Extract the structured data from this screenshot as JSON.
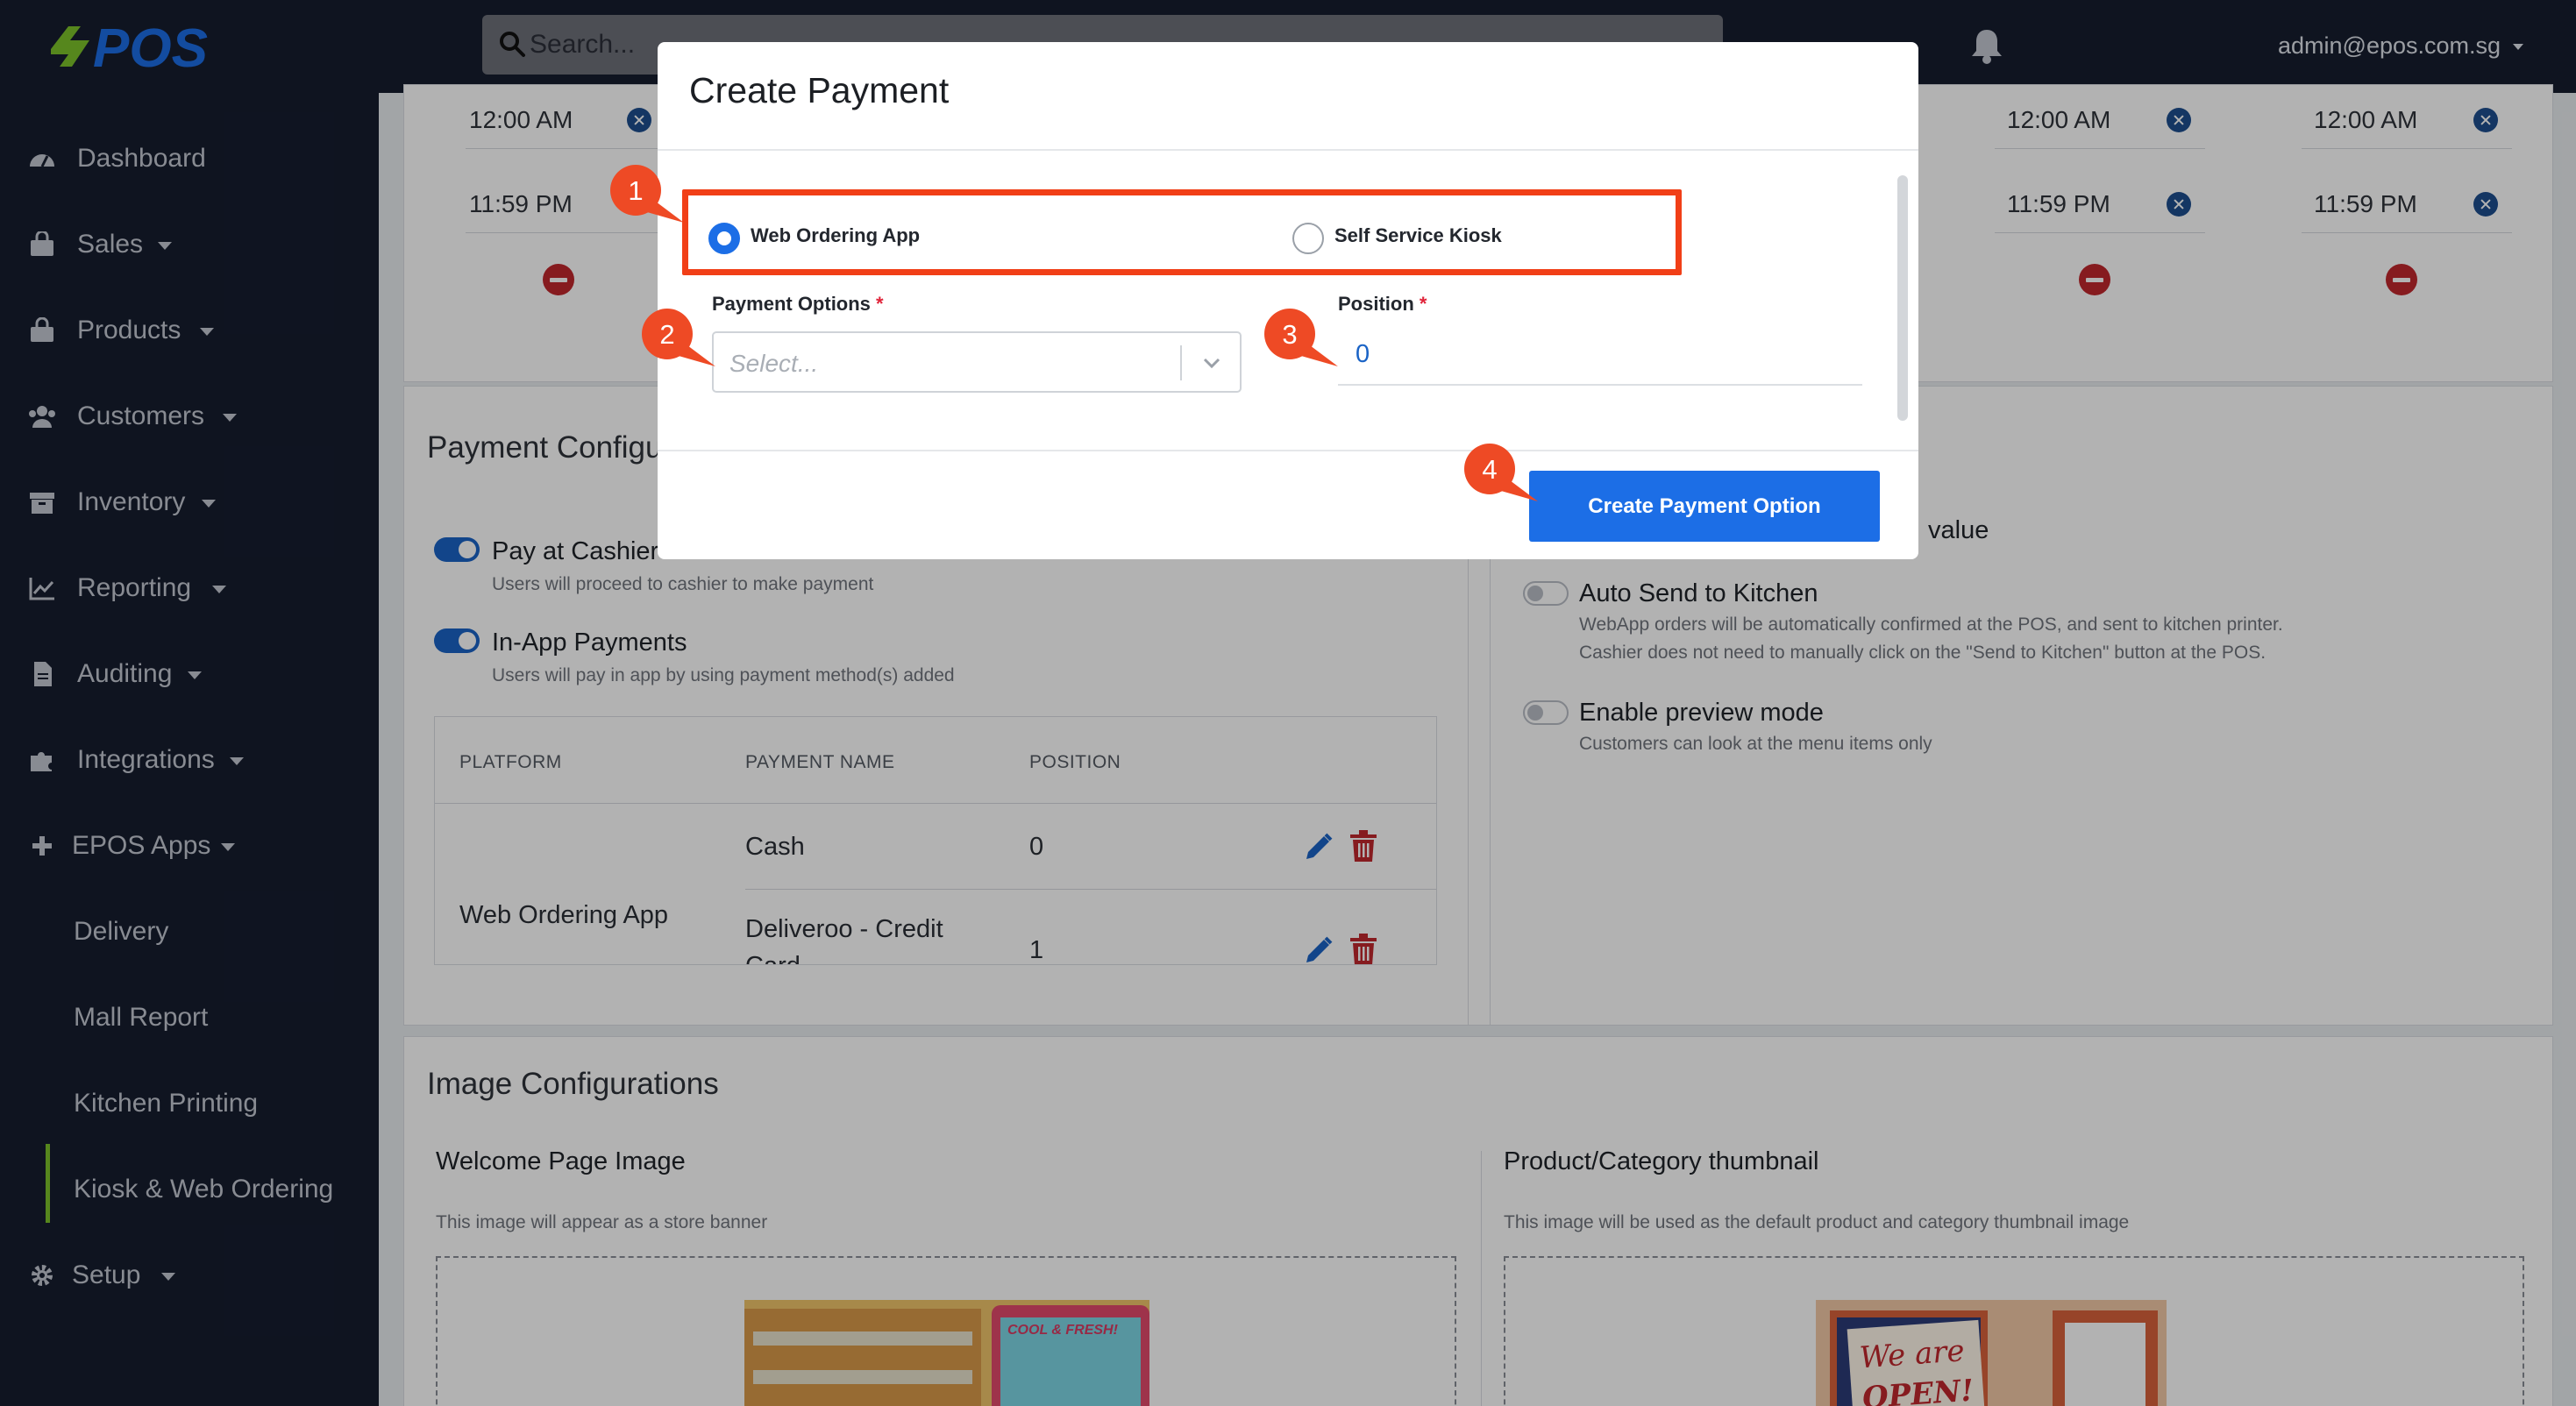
{
  "brand": {
    "logo_text": "ePOS",
    "green": "#7cc22a",
    "blue": "#1c6ee6",
    "navy": "#161d2f",
    "red": "#c0272d",
    "highlight": "#f13f17"
  },
  "topbar": {
    "search_placeholder": "Search...",
    "user": "admin@epos.com.sg"
  },
  "sidebar": {
    "items": [
      {
        "label": "Dashboard",
        "icon": "dashboard-icon",
        "caret": false
      },
      {
        "label": "Sales",
        "icon": "shopping-bag-icon",
        "caret": true
      },
      {
        "label": "Products",
        "icon": "bag-icon",
        "caret": true
      },
      {
        "label": "Customers",
        "icon": "users-icon",
        "caret": true
      },
      {
        "label": "Inventory",
        "icon": "archive-icon",
        "caret": true
      },
      {
        "label": "Reporting",
        "icon": "line-chart-icon",
        "caret": true
      },
      {
        "label": "Auditing",
        "icon": "document-icon",
        "caret": true
      },
      {
        "label": "Integrations",
        "icon": "puzzle-icon",
        "caret": true
      },
      {
        "label": "EPOS Apps",
        "icon": "plus-icon",
        "caret": true
      }
    ],
    "sub_items": [
      {
        "label": "Delivery"
      },
      {
        "label": "Mall Report"
      },
      {
        "label": "Kitchen Printing"
      },
      {
        "label": "Kiosk & Web Ordering",
        "active": true
      }
    ],
    "setup": {
      "label": "Setup",
      "icon": "gear-icon"
    }
  },
  "hours": {
    "open": "12:00 AM",
    "close": "11:59 PM"
  },
  "payment_config": {
    "title": "Payment Configurations",
    "options": [
      {
        "title": "Pay at Cashier",
        "desc": "Users will proceed to cashier to make payment",
        "on": true
      },
      {
        "title": "In-App Payments",
        "desc": "Users will pay in app by using payment method(s) added",
        "on": true
      }
    ],
    "table": {
      "headers": [
        "PLATFORM",
        "PAYMENT NAME",
        "POSITION"
      ],
      "platform": "Web Ordering App",
      "rows": [
        {
          "name": "Cash",
          "position": "0"
        },
        {
          "name_line1": "Deliveroo - Credit",
          "name_line2": "Card",
          "position": "1"
        }
      ]
    }
  },
  "other_config": {
    "partial_label": "value",
    "options": [
      {
        "title": "Auto Send to Kitchen",
        "desc1": "WebApp orders will be automatically confirmed at the POS, and sent to kitchen printer.",
        "desc2": "Cashier does not need to manually click on the \"Send to Kitchen\" button at the POS.",
        "on": false
      },
      {
        "title": "Enable preview mode",
        "desc1": "Customers can look at the menu items only",
        "on": false
      }
    ]
  },
  "image_config": {
    "title": "Image Configurations",
    "welcome": {
      "title": "Welcome Page Image",
      "desc": "This image will appear as a store banner",
      "image_text": "COOL & FRESH!"
    },
    "thumb": {
      "title": "Product/Category thumbnail",
      "desc": "This image will be used as the default product and category thumbnail image",
      "image_text_1": "We are",
      "image_text_2": "OPEN!"
    }
  },
  "modal": {
    "title": "Create Payment",
    "radio_options": [
      {
        "label": "Web Ordering App",
        "selected": true
      },
      {
        "label": "Self Service Kiosk",
        "selected": false
      }
    ],
    "payment_options_label": "Payment Options",
    "select_placeholder": "Select...",
    "position_label": "Position",
    "position_value": "0",
    "required_mark": "*",
    "submit": "Create Payment Option"
  },
  "callouts": [
    "1",
    "2",
    "3",
    "4"
  ]
}
